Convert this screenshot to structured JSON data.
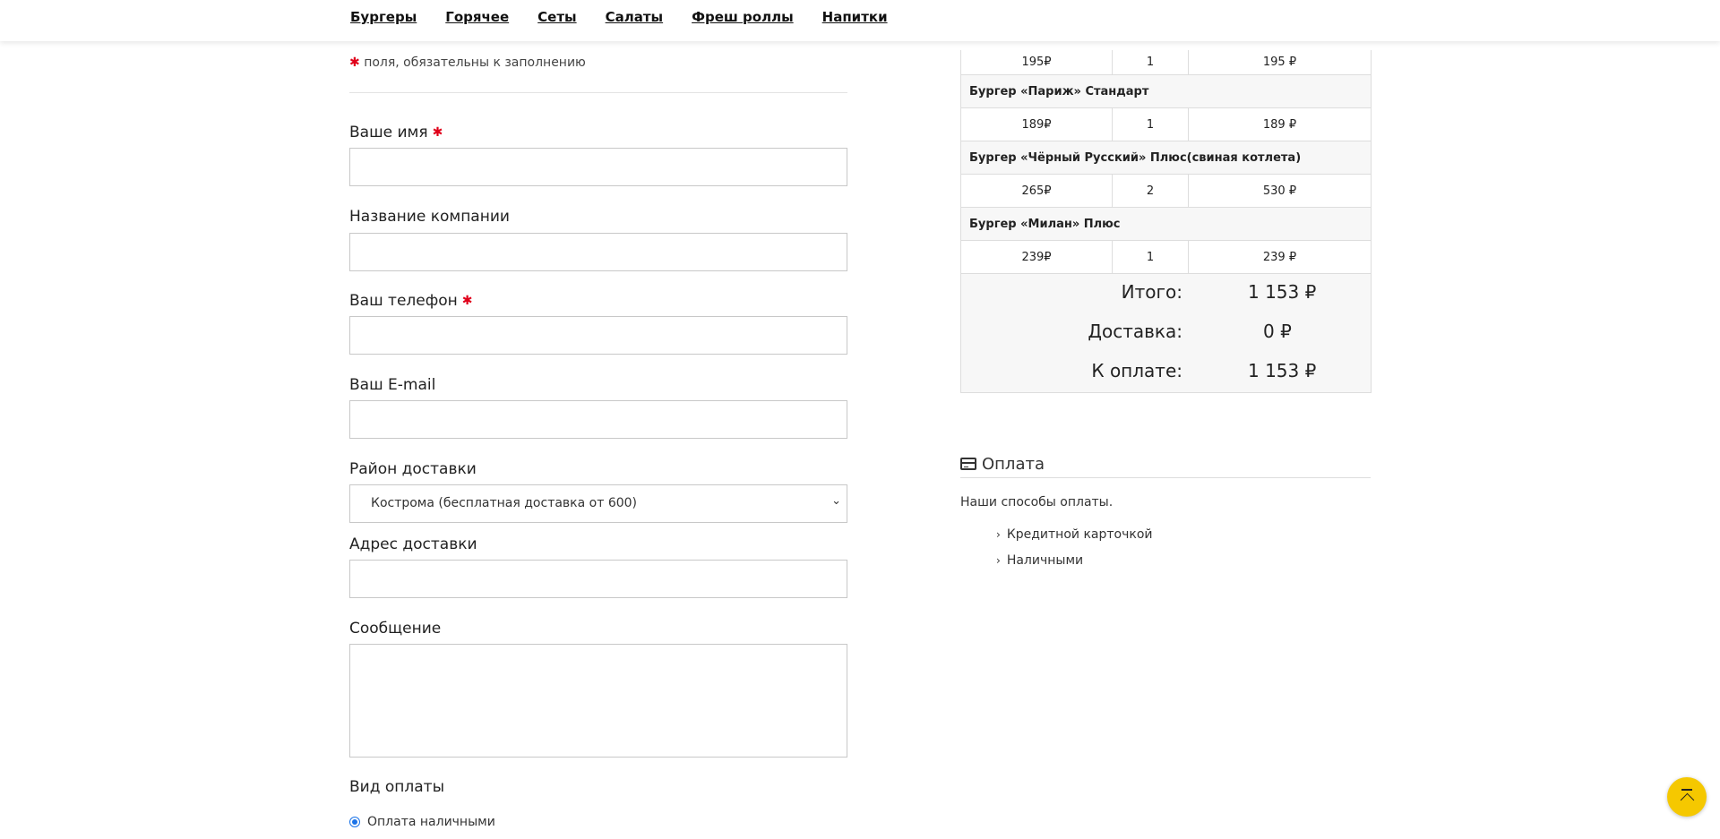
{
  "nav": {
    "items": [
      "Бургеры",
      "Горячее",
      "Сеты",
      "Салаты",
      "Фреш роллы",
      "Напитки"
    ]
  },
  "form": {
    "required_note": "поля, обязательны к заполнению",
    "required_mark": "✱",
    "name_label": "Ваше имя",
    "company_label": "Название компании",
    "phone_label": "Ваш телефон",
    "email_label": "Ваш E-mail",
    "district_label": "Район доставки",
    "district_value": "Кострома (бесплатная доставка от 600)",
    "address_label": "Адрес доставки",
    "message_label": "Сообщение",
    "payment_type_label": "Вид оплаты",
    "payment_option": "Оплата наличными"
  },
  "order": {
    "rows": [
      {
        "price": "195₽",
        "qty": "1",
        "sum": "195 ₽"
      },
      {
        "name": "Бургер «Париж» Стандарт",
        "price": "189₽",
        "qty": "1",
        "sum": "189 ₽"
      },
      {
        "name": "Бургер «Чёрный Русский» Плюс(свиная котлета)",
        "price": "265₽",
        "qty": "2",
        "sum": "530 ₽"
      },
      {
        "name": "Бургер «Милан» Плюс",
        "price": "239₽",
        "qty": "1",
        "sum": "239 ₽"
      }
    ],
    "totals": [
      {
        "label": "Итого:",
        "value": "1 153 ₽"
      },
      {
        "label": "Доставка:",
        "value": "0 ₽"
      },
      {
        "label": "К оплате:",
        "value": "1 153 ₽"
      }
    ]
  },
  "payment": {
    "title": "Оплата",
    "description": "Наши способы оплаты.",
    "methods": [
      "Кредитной карточкой",
      "Наличными"
    ]
  },
  "icons": {
    "card": "credit-card-icon",
    "arrow": "chevron-right-icon",
    "totop": "scroll-to-top-icon"
  },
  "colors": {
    "accent": "#f5c800",
    "required": "#e0001a",
    "radio": "#1a73e8"
  }
}
